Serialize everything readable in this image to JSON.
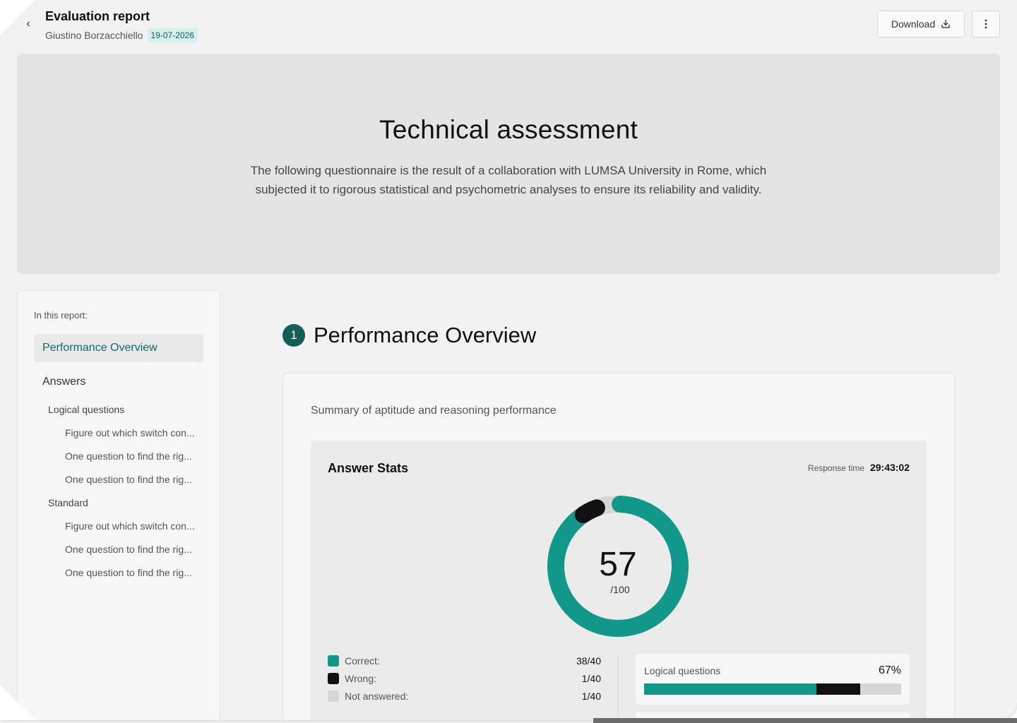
{
  "header": {
    "title": "Evaluation report",
    "candidate": "Giustino Borzacchiello",
    "date": "19-07-2026",
    "download_label": "Download"
  },
  "icons": {
    "back": "chevron-left-icon",
    "download": "download-icon",
    "more": "more-vertical-icon"
  },
  "hero": {
    "title": "Technical assessment",
    "description": "The following questionnaire is the result of a collaboration with LUMSA University in Rome, which subjected it to rigorous statistical and psychometric analyses to ensure its reliability and validity."
  },
  "toc": {
    "label": "In this report:",
    "active": "Performance Overview",
    "answers": "Answers",
    "groups": [
      {
        "label": "Logical questions",
        "items": [
          "Figure out which switch con...",
          "One question to find the rig...",
          "One question to find the rig..."
        ]
      },
      {
        "label": "Standard",
        "items": [
          "Figure out which switch con...",
          "One question to find the rig...",
          "One question to find the rig..."
        ]
      }
    ]
  },
  "section": {
    "number": "1",
    "title": "Performance Overview",
    "subtitle": "Summary of aptitude and reasoning performance"
  },
  "stats": {
    "title": "Answer Stats",
    "response_time_label": "Response time",
    "response_time": "29:43:02",
    "score": "57",
    "score_max": "/100",
    "legend": [
      {
        "label": "Correct:",
        "value": "38/40"
      },
      {
        "label": "Wrong:",
        "value": "1/40"
      },
      {
        "label": "Not answered:",
        "value": "1/40"
      }
    ],
    "logical": {
      "label": "Logical questions",
      "value": "67%"
    }
  },
  "chart_data": {
    "type": "pie",
    "style": "donut",
    "categories": [
      "Correct",
      "Wrong",
      "Not answered"
    ],
    "values": [
      38,
      1,
      1
    ],
    "center_label": "57",
    "center_sublabel": "/100",
    "colors": [
      "#12988a",
      "#111111",
      "#d6d6d6"
    ],
    "bar": {
      "type": "bar",
      "style": "stacked-horizontal",
      "label": "Logical questions",
      "percent_label": "67%",
      "segments": [
        {
          "name": "Correct",
          "value": 67
        },
        {
          "name": "Wrong",
          "value": 17
        },
        {
          "name": "Not answered",
          "value": 16
        }
      ],
      "colors": [
        "#12988a",
        "#111111",
        "#d6d6d6"
      ]
    }
  },
  "colors": {
    "accent": "#0f6d63",
    "teal": "#12988a",
    "wrong": "#111111",
    "not_answered": "#d6d6d6",
    "badge_bg": "#d5f1ed"
  }
}
